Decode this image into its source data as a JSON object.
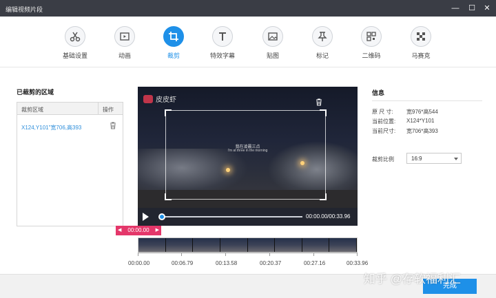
{
  "window": {
    "title": "编辑视频片段",
    "controls": {
      "minimize": "—",
      "maximize": "☐",
      "close": "✕"
    }
  },
  "toolbar": {
    "tools": [
      {
        "label": "基础设置",
        "icon": "scissors-icon"
      },
      {
        "label": "动画",
        "icon": "animation-icon"
      },
      {
        "label": "裁剪",
        "icon": "crop-icon",
        "active": true
      },
      {
        "label": "特效字幕",
        "icon": "text-icon"
      },
      {
        "label": "贴图",
        "icon": "image-icon"
      },
      {
        "label": "标记",
        "icon": "pin-icon"
      },
      {
        "label": "二维码",
        "icon": "qrcode-icon"
      },
      {
        "label": "马赛克",
        "icon": "mosaic-icon"
      }
    ],
    "accent": "#1e90e8"
  },
  "regions": {
    "title": "已裁剪的区域",
    "col_region": "裁剪区域",
    "col_action": "操作",
    "rows": [
      {
        "text": "X124,Y101\"宽706,高393",
        "action_icon": "trash-icon"
      }
    ]
  },
  "preview": {
    "watermark": "皮皮虾",
    "subtitle_cn": "我在凌晨三点",
    "subtitle_en": "I'm at three in the morning",
    "current_time": "00:00.00",
    "duration": "00:33.96",
    "time_display": "00:00.00/00:33.96",
    "progress": 0.0
  },
  "timeline": {
    "marker_label": "00:00.00",
    "ticks": [
      "00:00.00",
      "00:06.79",
      "00:13.58",
      "00:20.37",
      "00:27.16",
      "00:33.96"
    ]
  },
  "info": {
    "title": "信息",
    "original_size_label": "原 尺 寸:",
    "original_size_value": "宽976*高544",
    "position_label": "当前位置:",
    "position_value": "X124*Y101",
    "size_label": "当前尺寸:",
    "size_value": "宽706*高393",
    "ratio_label": "裁剪比例",
    "ratio_value": "16:9"
  },
  "footer": {
    "done_label": "完成"
  },
  "overlay_watermark": "知乎 @存软福利汇"
}
